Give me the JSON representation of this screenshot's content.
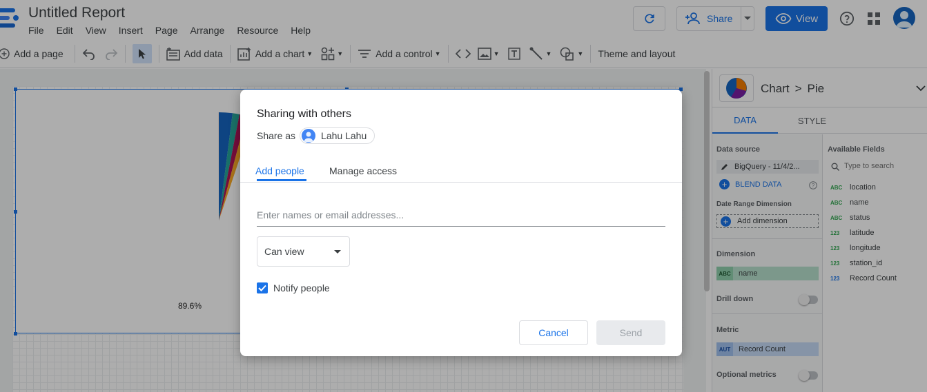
{
  "header": {
    "title": "Untitled Report",
    "menu": [
      "File",
      "Edit",
      "View",
      "Insert",
      "Page",
      "Arrange",
      "Resource",
      "Help"
    ],
    "share_label": "Share",
    "view_label": "View",
    "brand_color": "#1a73e8"
  },
  "toolbar": {
    "add_page": "Add a page",
    "add_data": "Add data",
    "add_chart": "Add a chart",
    "add_control": "Add a control",
    "theme_layout": "Theme and layout"
  },
  "canvas": {
    "pie_label": "89.6%"
  },
  "panel": {
    "crumb_root": "Chart",
    "crumb_leaf": "Pie",
    "tabs": [
      "DATA",
      "STYLE"
    ],
    "data_source_label": "Data source",
    "data_source_value": "BigQuery - 11/4/2...",
    "blend_data": "BLEND DATA",
    "date_range_label": "Date Range Dimension",
    "add_dimension": "Add dimension",
    "dimension_label": "Dimension",
    "dimension_value": "name",
    "dimension_type": "ABC",
    "drill_down": "Drill down",
    "metric_label": "Metric",
    "metric_value": "Record Count",
    "metric_type": "AUT",
    "optional_metrics": "Optional metrics",
    "available_fields_label": "Available Fields",
    "search_placeholder": "Type to search",
    "fields": [
      {
        "type": "ABC",
        "name": "location"
      },
      {
        "type": "ABC",
        "name": "name"
      },
      {
        "type": "ABC",
        "name": "status"
      },
      {
        "type": "123",
        "name": "latitude"
      },
      {
        "type": "123",
        "name": "longitude"
      },
      {
        "type": "123",
        "name": "station_id"
      },
      {
        "type": "123",
        "name": "Record Count"
      }
    ]
  },
  "dialog": {
    "title": "Sharing with others",
    "share_as_label": "Share as",
    "user_name": "Lahu Lahu",
    "tab_add": "Add people",
    "tab_manage": "Manage access",
    "email_placeholder": "Enter names or email addresses...",
    "permission": "Can view",
    "notify_label": "Notify people",
    "notify_checked": true,
    "cancel_label": "Cancel",
    "send_label": "Send"
  }
}
